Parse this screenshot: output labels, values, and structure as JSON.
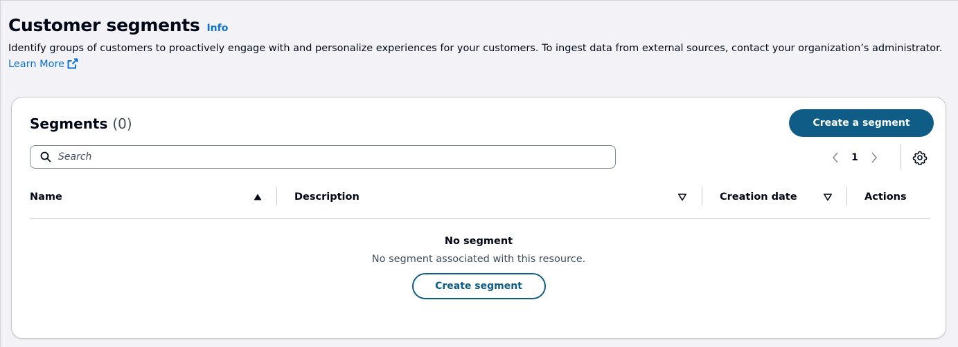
{
  "header": {
    "title": "Customer segments",
    "info_label": "Info",
    "description": "Identify groups of customers to proactively engage with and personalize experiences for your customers. To ingest data from external sources, contact your organization’s administrator.",
    "learn_more_label": "Learn More",
    "learn_more_icon": "external-link-icon"
  },
  "panel": {
    "title": "Segments",
    "count": "(0)",
    "create_button_label": "Create a segment",
    "search": {
      "placeholder": "Search",
      "value": "",
      "icon": "search-icon"
    },
    "pagination": {
      "current_page": "1",
      "prev_icon": "chevron-left-icon",
      "next_icon": "chevron-right-icon"
    },
    "settings_icon": "gear-icon"
  },
  "table": {
    "columns": [
      {
        "label": "Name",
        "sort": "ascending"
      },
      {
        "label": "Description",
        "sort": "none"
      },
      {
        "label": "Creation date",
        "sort": "none"
      },
      {
        "label": "Actions",
        "sort": ""
      }
    ],
    "rows": []
  },
  "empty_state": {
    "title": "No segment",
    "description": "No segment associated with this resource.",
    "button_label": "Create segment"
  },
  "colors": {
    "link": "#0972d3",
    "primary_button": "#0f5d87",
    "background": "#f3f3f7",
    "border": "#c6c6cd"
  }
}
